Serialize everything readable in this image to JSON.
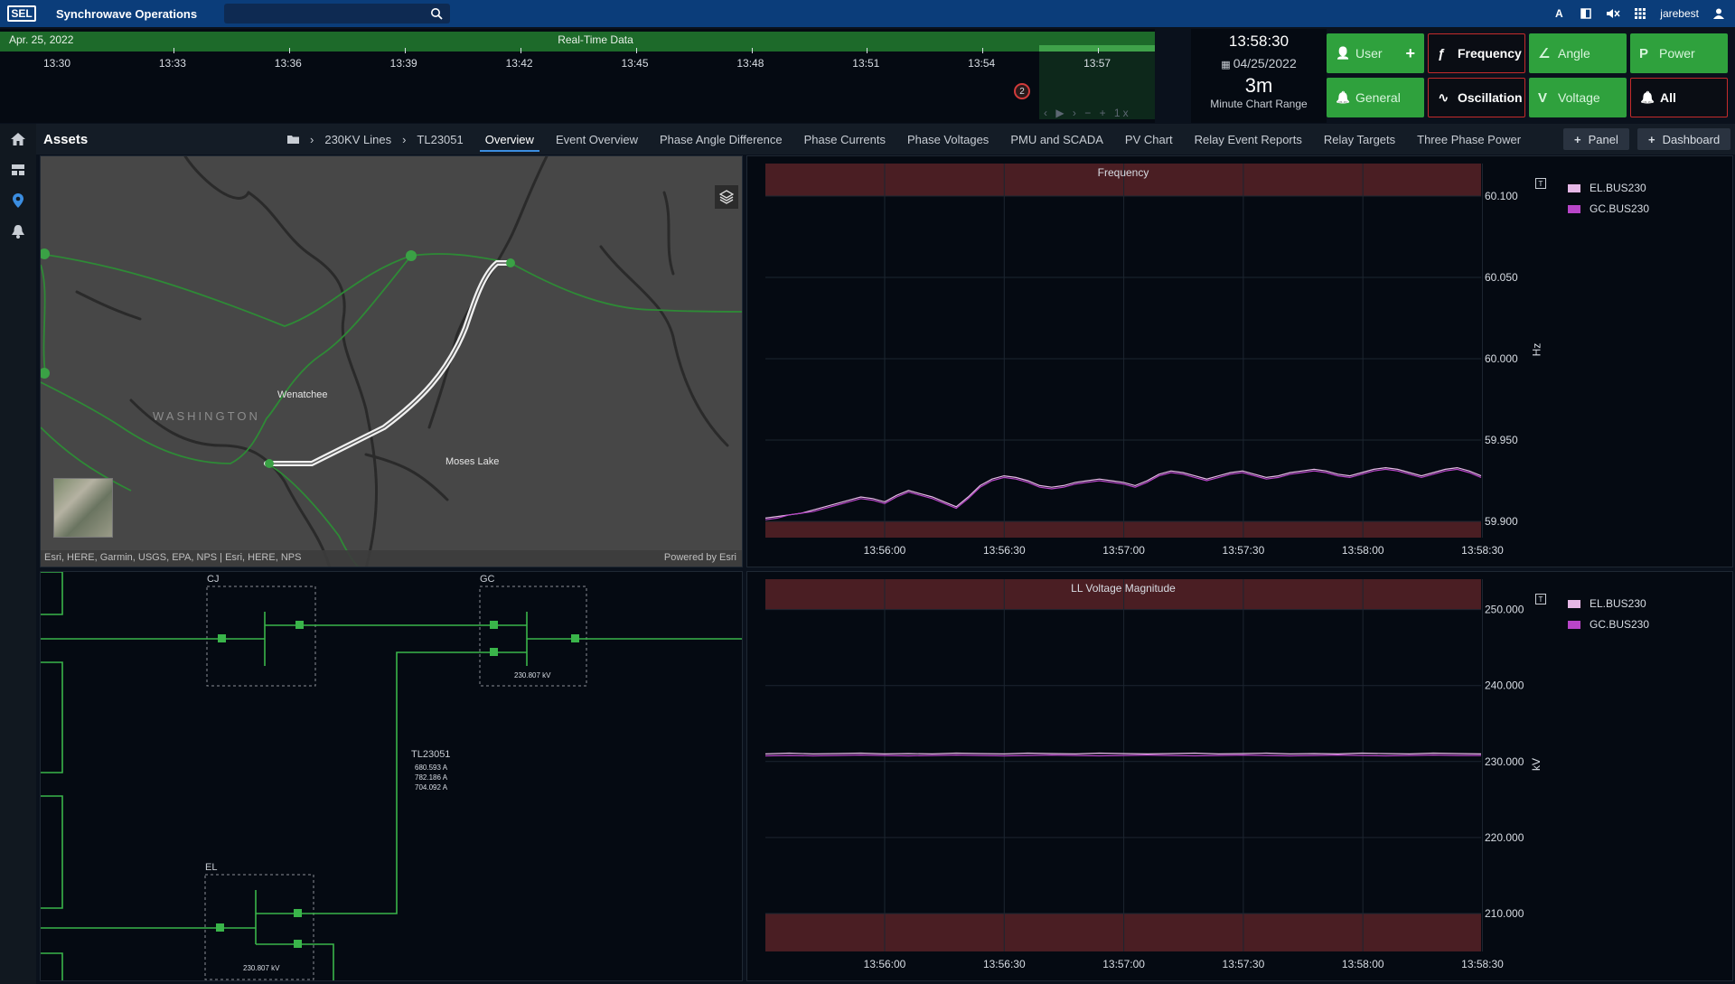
{
  "app": {
    "logo": "SEL",
    "title": "Synchrowave Operations",
    "search_placeholder": "",
    "user": "jarebest"
  },
  "topbar_icons": [
    "font-size-icon",
    "contrast-icon",
    "mute-icon",
    "apps-grid-icon",
    "user-icon"
  ],
  "timeline": {
    "date": "Apr. 25, 2022",
    "title": "Real-Time Data",
    "ticks": [
      "13:30",
      "13:33",
      "13:36",
      "13:39",
      "13:42",
      "13:45",
      "13:48",
      "13:51",
      "13:54",
      "13:57"
    ],
    "badge": "2",
    "controls": "‹ ▶ › − + 1x"
  },
  "clock": {
    "time": "13:58:30",
    "date": "04/25/2022",
    "range": "3m",
    "range_label": "Minute Chart Range"
  },
  "quick_buttons": [
    {
      "label": "User",
      "icon": "user-icon",
      "glyph": "👤",
      "style": "green",
      "plus": true
    },
    {
      "label": "Frequency",
      "icon": "frequency-icon",
      "glyph": "ƒ",
      "style": "red"
    },
    {
      "label": "Angle",
      "icon": "angle-icon",
      "glyph": "∠",
      "style": "green"
    },
    {
      "label": "Power",
      "icon": "power-icon",
      "glyph": "P",
      "style": "green"
    },
    {
      "label": "General",
      "icon": "bell-icon",
      "glyph": "🔔",
      "style": "green"
    },
    {
      "label": "Oscillation",
      "icon": "oscillation-icon",
      "glyph": "∿",
      "style": "red"
    },
    {
      "label": "Voltage",
      "icon": "voltage-icon",
      "glyph": "V",
      "style": "green"
    },
    {
      "label": "All",
      "icon": "bell-icon",
      "glyph": "🔔",
      "style": "red"
    }
  ],
  "sidebar": [
    "home-icon",
    "dashboard-icon",
    "location-icon",
    "alarm-icon"
  ],
  "tabbar": {
    "title": "Assets",
    "breadcrumb": [
      "230KV Lines",
      "TL23051"
    ],
    "tabs": [
      "Overview",
      "Event Overview",
      "Phase Angle Difference",
      "Phase Currents",
      "Phase Voltages",
      "PMU and SCADA",
      "PV Chart",
      "Relay Event Reports",
      "Relay Targets",
      "Three Phase Power"
    ],
    "active_tab": "Overview",
    "panel_button": "Panel",
    "dashboard_button": "Dashboard"
  },
  "map": {
    "labels": {
      "city1": "Wenatchee",
      "state": "WASHINGTON",
      "city2": "Moses Lake"
    },
    "attribution_left": "Esri, HERE, Garmin, USGS, EPA, NPS | Esri, HERE, NPS",
    "attribution_right": "Powered by Esri"
  },
  "diagram": {
    "stations": [
      "CJ",
      "GC",
      "EL"
    ],
    "gc_voltage": "230.807 kV",
    "el_voltage": "230.807 kV",
    "line_name": "TL23051",
    "currents": [
      "680.593 A",
      "782.186 A",
      "704.092 A"
    ]
  },
  "chart_data": [
    {
      "type": "line",
      "title": "Frequency",
      "ylabel": "Hz",
      "ylim": [
        59.89,
        60.12
      ],
      "yticks": [
        "60.100",
        "60.050",
        "60.000",
        "59.950",
        "59.900"
      ],
      "yticks_values": [
        60.1,
        60.05,
        60.0,
        59.95,
        59.9
      ],
      "xticks": [
        "13:56:00",
        "13:56:30",
        "13:57:00",
        "13:57:30",
        "13:58:00",
        "13:58:30"
      ],
      "alarm_bands": [
        [
          60.1,
          60.12
        ],
        [
          59.89,
          59.9
        ]
      ],
      "series": [
        {
          "name": "EL.BUS230",
          "color": "#e6b8e6",
          "values": [
            59.902,
            59.903,
            59.904,
            59.905,
            59.907,
            59.909,
            59.911,
            59.913,
            59.915,
            59.914,
            59.912,
            59.916,
            59.919,
            59.917,
            59.915,
            59.912,
            59.909,
            59.915,
            59.922,
            59.926,
            59.928,
            59.927,
            59.925,
            59.922,
            59.921,
            59.922,
            59.924,
            59.925,
            59.926,
            59.925,
            59.924,
            59.922,
            59.925,
            59.929,
            59.931,
            59.93,
            59.928,
            59.926,
            59.928,
            59.93,
            59.931,
            59.929,
            59.927,
            59.928,
            59.93,
            59.931,
            59.932,
            59.931,
            59.929,
            59.928,
            59.93,
            59.932,
            59.933,
            59.932,
            59.93,
            59.928,
            59.93,
            59.932,
            59.933,
            59.931,
            59.928
          ]
        },
        {
          "name": "GC.BUS230",
          "color": "#b845c8",
          "values": [
            59.901,
            59.902,
            59.904,
            59.905,
            59.906,
            59.908,
            59.91,
            59.912,
            59.914,
            59.913,
            59.911,
            59.915,
            59.918,
            59.916,
            59.914,
            59.911,
            59.908,
            59.914,
            59.921,
            59.925,
            59.927,
            59.926,
            59.924,
            59.921,
            59.92,
            59.921,
            59.923,
            59.924,
            59.925,
            59.924,
            59.923,
            59.921,
            59.924,
            59.928,
            59.93,
            59.929,
            59.927,
            59.925,
            59.927,
            59.929,
            59.93,
            59.928,
            59.926,
            59.927,
            59.929,
            59.93,
            59.931,
            59.93,
            59.928,
            59.927,
            59.929,
            59.931,
            59.932,
            59.931,
            59.929,
            59.927,
            59.929,
            59.931,
            59.932,
            59.93,
            59.927
          ]
        }
      ]
    },
    {
      "type": "line",
      "title": "LL Voltage Magnitude",
      "ylabel": "kV",
      "ylim": [
        205,
        254
      ],
      "yticks": [
        "250.000",
        "240.000",
        "230.000",
        "220.000",
        "210.000"
      ],
      "yticks_values": [
        250,
        240,
        230,
        220,
        210
      ],
      "xticks": [
        "13:56:00",
        "13:56:30",
        "13:57:00",
        "13:57:30",
        "13:58:00",
        "13:58:30"
      ],
      "alarm_bands": [
        [
          250,
          254
        ],
        [
          205,
          210
        ]
      ],
      "series": [
        {
          "name": "EL.BUS230",
          "color": "#e6b8e6",
          "values": [
            231.0,
            231.1,
            231.0,
            231.05,
            231.1,
            231.0,
            231.05,
            231.0,
            231.1,
            231.05,
            231.0,
            231.1,
            231.05,
            231.0,
            231.1,
            231.05,
            231.0,
            231.05,
            231.1,
            231.0,
            231.05,
            231.1,
            231.0,
            231.05,
            231.0,
            231.1,
            231.05,
            231.0,
            231.1,
            231.05,
            231.0
          ]
        },
        {
          "name": "GC.BUS230",
          "color": "#b845c8",
          "values": [
            230.75,
            230.8,
            230.75,
            230.8,
            230.85,
            230.8,
            230.75,
            230.8,
            230.85,
            230.8,
            230.75,
            230.8,
            230.85,
            230.8,
            230.75,
            230.8,
            230.85,
            230.8,
            230.75,
            230.8,
            230.85,
            230.8,
            230.75,
            230.8,
            230.85,
            230.8,
            230.75,
            230.8,
            230.85,
            230.8,
            230.8
          ]
        }
      ]
    }
  ]
}
